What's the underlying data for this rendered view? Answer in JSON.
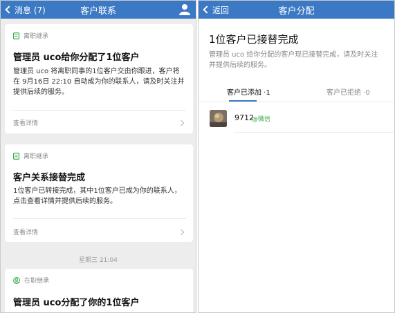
{
  "left": {
    "nav": {
      "back_label": "消息 (7)",
      "title": "客户联系"
    },
    "cards": [
      {
        "tag": "离职继承",
        "title": "管理员 uco给你分配了1位客户",
        "body": "管理员 uco 将离职同事的1位客户交由你跟进，客户将在 9月16日 22:10 自动成为你的联系人，请及时关注并提供后续的服务。",
        "link": "查看详情"
      },
      {
        "tag": "离职继承",
        "title": "客户关系接替完成",
        "body": "1位客户已转接完成，其中1位客户已成为你的联系人，点击查看详情并提供后续的服务。",
        "link": "查看详情"
      },
      {
        "tag": "在职继承",
        "title": "管理员 uco分配了你的1位客户"
      }
    ],
    "timestamp": "星期三 21:04"
  },
  "right": {
    "nav": {
      "back_label": "返回",
      "title": "客户分配"
    },
    "heading": "1位客户已接替完成",
    "description": "管理员 uco 给你分配的客户现已接替完成，请及时关注并提供后续的服务。",
    "tabs": [
      {
        "label": "客户已添加 ·1",
        "active": true
      },
      {
        "label": "客户已拒绝 ·0",
        "active": false
      }
    ],
    "contacts": [
      {
        "name": "9712",
        "source": "@微信"
      }
    ]
  },
  "colors": {
    "nav_bg": "#3c79c4",
    "accent_green": "#3aaa4f",
    "page_bg": "#ededed"
  },
  "icons": [
    "person-icon",
    "document-icon",
    "user-circle-icon",
    "chevron-left-icon",
    "chevron-right-icon"
  ]
}
